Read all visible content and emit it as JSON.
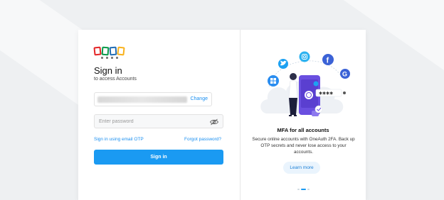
{
  "login": {
    "title": "Sign in",
    "subtitle": "to access Accounts",
    "change_label": "Change",
    "password_placeholder": "Enter password",
    "otp_link": "Sign in using email OTP",
    "forgot_link": "Forgot password?",
    "submit_label": "Sign in"
  },
  "promo": {
    "title": "MFA for all accounts",
    "description": "Secure online accounts with OneAuth 2FA. Back up OTP secrets and never lose access to your accounts.",
    "learn_more": "Learn more",
    "carousel_active_index": 1,
    "carousel_count": 3
  },
  "colors": {
    "accent": "#1a9af2",
    "logo_red": "#e42527",
    "logo_green": "#089949",
    "logo_blue": "#226db4",
    "logo_yellow": "#f9b21d"
  },
  "icons": [
    "zoho-logo",
    "eye-slash-icon",
    "twitter-icon",
    "instagram-icon",
    "facebook-icon",
    "google-icon",
    "windows-icon",
    "fingerprint-icon"
  ]
}
